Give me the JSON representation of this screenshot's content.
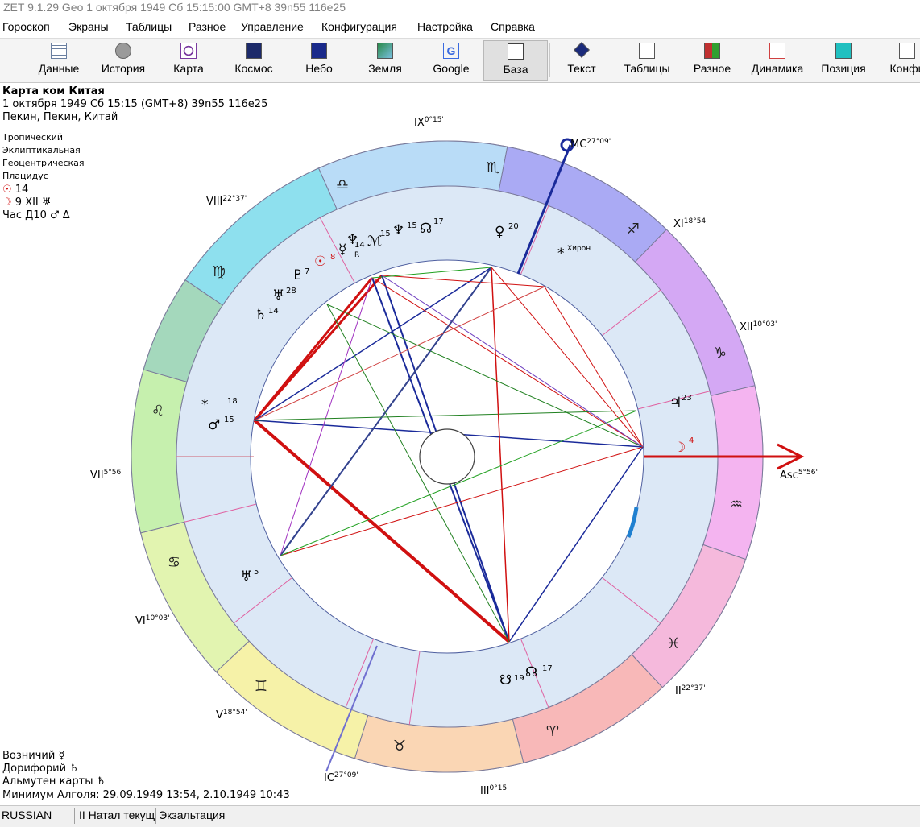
{
  "window": {
    "title": "ZET 9.1.29 Geo    1 октября 1949  Сб  15:15:00 GMT+8 39n55  116e25"
  },
  "menu": [
    "Гороскоп",
    "Экраны",
    "Таблицы",
    "Разное",
    "Управление",
    "Конфигурация",
    "Настройка",
    "Справка"
  ],
  "toolbar": [
    {
      "label": "Данные",
      "icon": "data-grid-icon",
      "color": "#6a7fa0"
    },
    {
      "label": "История",
      "icon": "history-disc-icon",
      "color": "#8a8a8a"
    },
    {
      "label": "Карта",
      "icon": "chart-circle-icon",
      "color": "#7a3aa0"
    },
    {
      "label": "Космос",
      "icon": "cosmos-icon",
      "color": "#1c2a6a"
    },
    {
      "label": "Небо",
      "icon": "sky-icon",
      "color": "#1a2a8a"
    },
    {
      "label": "Земля",
      "icon": "earth-map-icon",
      "color": "#2a8a4a"
    },
    {
      "label": "Google",
      "icon": "google-icon",
      "color": "#3a6adf"
    },
    {
      "label": "База",
      "icon": "database-icon",
      "color": "#404040"
    },
    {
      "label": "Текст",
      "icon": "text-icon",
      "color": "#1a2a7a"
    },
    {
      "label": "Таблицы",
      "icon": "tables-icon",
      "color": "#505050"
    },
    {
      "label": "Разное",
      "icon": "misc-grid-icon",
      "color": "#c03030"
    },
    {
      "label": "Динамика",
      "icon": "dynamics-icon",
      "color": "#d04040"
    },
    {
      "label": "Позиция",
      "icon": "position-icon",
      "color": "#20a0a0"
    },
    {
      "label": "Конфи",
      "icon": "config-icon",
      "color": "#606060"
    }
  ],
  "header": {
    "title": "Карта ком Китая",
    "date_line": "1 октября 1949  Сб  15:15 (GMT+8) 39n55  116e25",
    "place_line": "Пекин, Пекин, Китай"
  },
  "settings": [
    "Тропический",
    "Эклиптикальная",
    "Геоцентрическая",
    "Плацидус"
  ],
  "info_lines": [
    {
      "glyph": "☉",
      "text": " 14",
      "color": "#d01010"
    },
    {
      "glyph": "☽",
      "text": " 9 XII ♅",
      "color": "#d01010"
    },
    {
      "glyph": "",
      "text": "Час Д10  ♂ Δ",
      "color": "#000000"
    }
  ],
  "houses": {
    "IX": "IX",
    "IX_deg": "0°15'",
    "MC": "MC",
    "MC_deg": "27°09'",
    "XI": "XI",
    "XI_deg": "18°54'",
    "XII": "XII",
    "XII_deg": "10°03'",
    "Asc": "Asc",
    "Asc_deg": "5°56'",
    "II": "II",
    "II_deg": "22°37'",
    "III": "III",
    "III_deg": "0°15'",
    "IC": "IC",
    "IC_deg": "27°09'",
    "V": "V",
    "V_deg": "18°54'",
    "VI": "VI",
    "VI_deg": "10°03'",
    "VII": "VII",
    "VII_deg": "5°56'",
    "VIII": "VIII",
    "VIII_deg": "22°37'"
  },
  "signs": {
    "libra": "♎",
    "scorpio": "♏",
    "sagittarius": "♐",
    "capricorn": "♑",
    "aquarius": "♒",
    "pisces": "♓",
    "aries": "♈",
    "taurus": "♉",
    "gemini": "♊",
    "cancer": "♋",
    "leo": "♌",
    "virgo": "♍"
  },
  "sign_colors": {
    "libra": "#8ee0ee",
    "scorpio": "#b9dcf7",
    "sagittarius": "#aaaaf4",
    "capricorn": "#d4a8f4",
    "aquarius": "#f4b4f0",
    "pisces": "#f5b9dc",
    "aries": "#f8b8b8",
    "taurus": "#fad6b4",
    "gemini": "#f6f2a8",
    "cancer": "#e2f4b0",
    "leo": "#c6f0ae",
    "virgo": "#a4d8bc"
  },
  "planets": {
    "sun": {
      "glyph": "☉",
      "deg": "8"
    },
    "mercury": {
      "glyph": "☿",
      "deg": "14",
      "retro": "R"
    },
    "neptune": {
      "glyph": "♆",
      "deg": "15"
    },
    "pluto_k": {
      "glyph": "♇",
      "deg": "7"
    },
    "uranus_q": {
      "glyph": "♅",
      "deg": "28"
    },
    "saturn": {
      "glyph": "♄",
      "deg": "14"
    },
    "hades": {
      "glyph": "ℳ",
      "deg": "15"
    },
    "chiron_node": {
      "glyph": "☊",
      "deg": "17"
    },
    "venus": {
      "glyph": "♀",
      "deg": "20"
    },
    "chiron": {
      "glyph": "*",
      "label": "Хирон"
    },
    "jupiter": {
      "glyph": "♃",
      "deg": "23"
    },
    "moon": {
      "glyph": "☽",
      "deg": "4"
    },
    "mars": {
      "glyph": "♂",
      "deg": "15"
    },
    "star18": {
      "glyph": "*",
      "deg": "18"
    },
    "uranus": {
      "glyph": "♅",
      "deg": "5"
    },
    "lilith": {
      "glyph": "☋",
      "deg": "19"
    },
    "node": {
      "glyph": "☊",
      "deg": "17"
    }
  },
  "bottom": [
    {
      "label": "Возничий",
      "glyph": "☿"
    },
    {
      "label": "Дорифорий",
      "glyph": "♄"
    },
    {
      "label": "Альмутен карты",
      "glyph": "♄"
    },
    {
      "label": "Минимум Алголя: 29.09.1949 13:54,  2.10.1949 10:43",
      "glyph": ""
    }
  ],
  "status": [
    "RUSSIAN",
    "II Натал текущ",
    "Экзальтация"
  ]
}
